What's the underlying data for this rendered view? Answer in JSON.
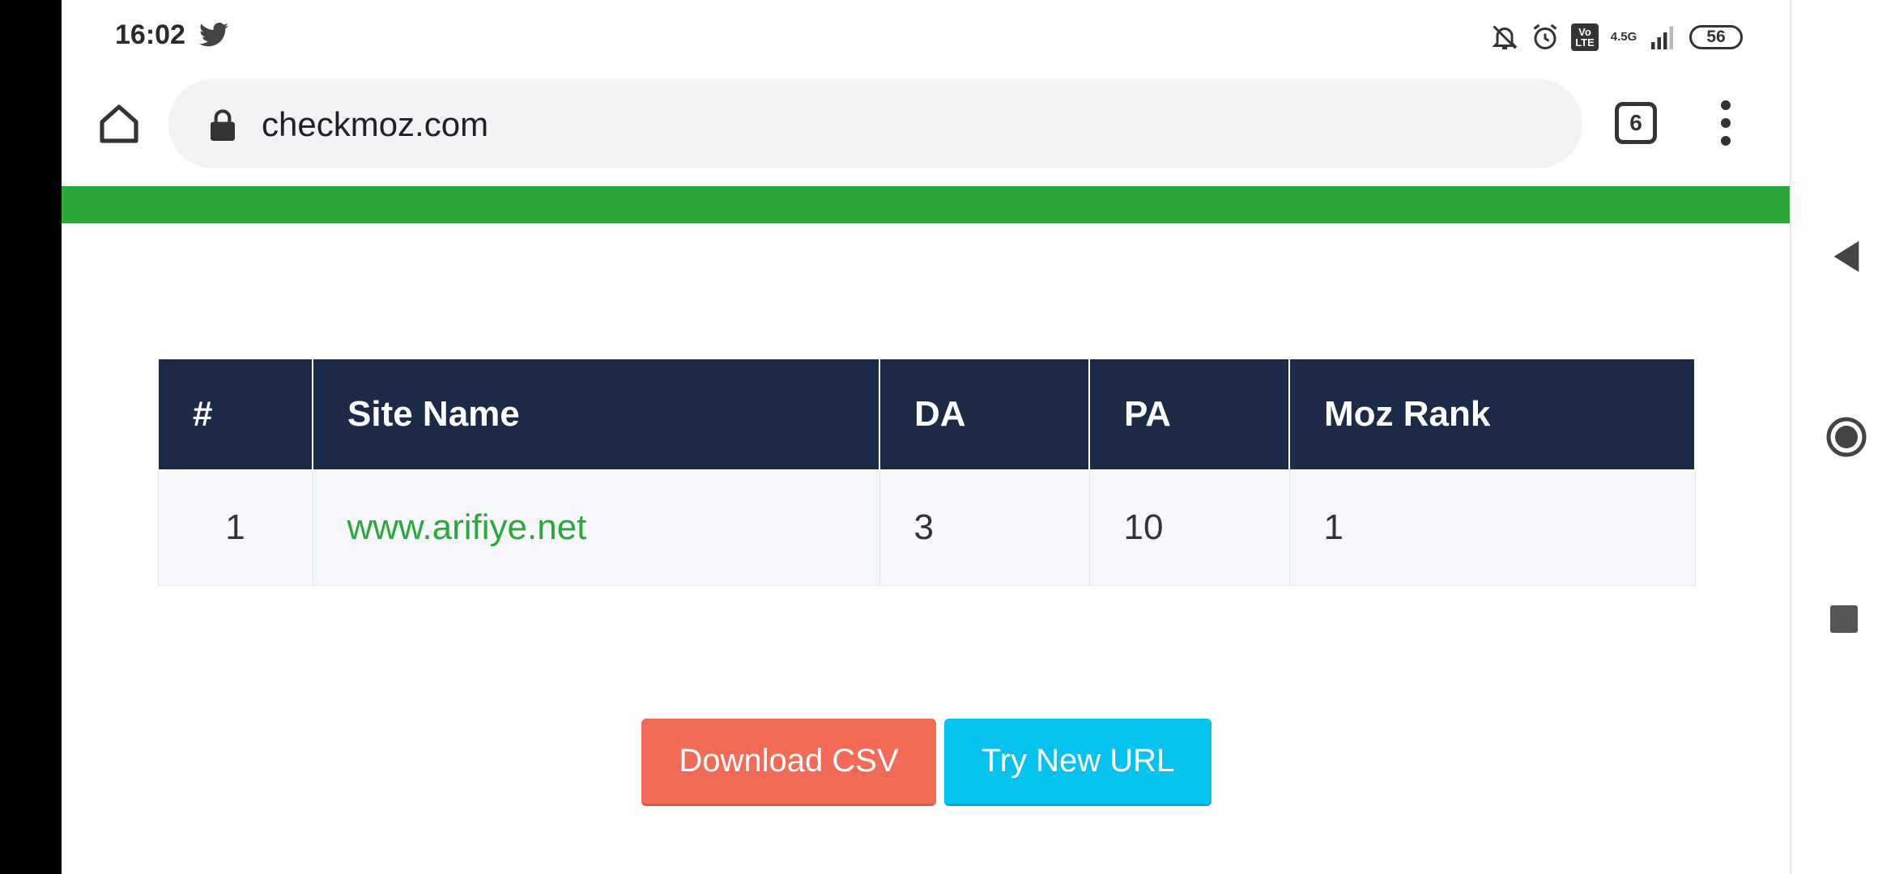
{
  "status_bar": {
    "time": "16:02",
    "network_label": "4.5G",
    "volte_label": "Vo LTE",
    "battery": "56",
    "icons": [
      "twitter-icon",
      "mute-icon",
      "alarm-icon",
      "volte-icon",
      "signal-icon",
      "battery-icon"
    ]
  },
  "browser": {
    "url": "checkmoz.com",
    "tab_count": "6",
    "icons": [
      "home-icon",
      "lock-icon",
      "tabs-icon",
      "more-vert-icon"
    ]
  },
  "page": {
    "accent_color": "#28a93a",
    "table": {
      "headers": [
        "#",
        "Site Name",
        "DA",
        "PA",
        "Moz Rank"
      ],
      "rows": [
        {
          "index": "1",
          "site": "www.arifiye.net",
          "da": "3",
          "pa": "10",
          "moz_rank": "1"
        }
      ]
    },
    "buttons": {
      "download_csv": "Download CSV",
      "try_new_url": "Try New URL"
    }
  },
  "colors": {
    "header_bg": "#1b2b47",
    "green": "#28a93a",
    "csv_button": "#f26b56",
    "url_button": "#05c2ee"
  },
  "nav": {
    "icons": [
      "back-icon",
      "home-circle-icon",
      "recents-icon"
    ]
  }
}
